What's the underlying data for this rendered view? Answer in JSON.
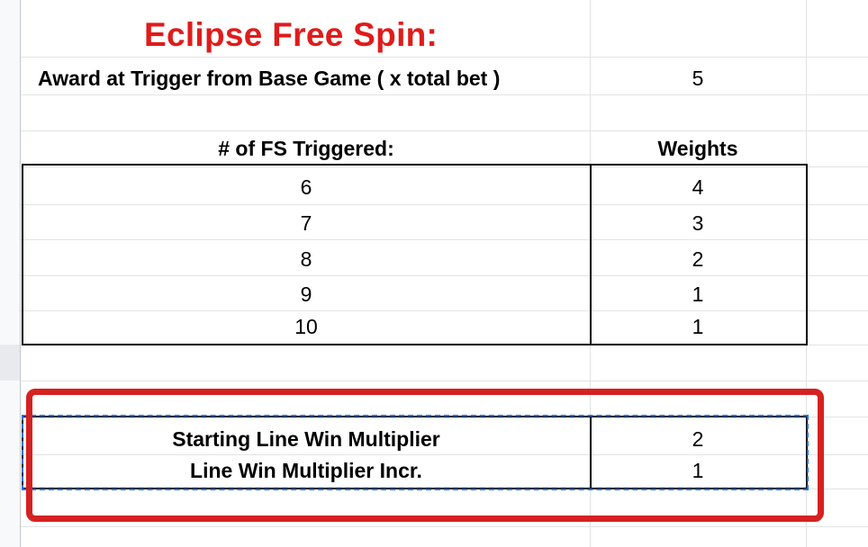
{
  "title": "Eclipse Free Spin:",
  "award": {
    "label": "Award at Trigger from Base Game ( x total bet )",
    "value": "5"
  },
  "fs_table": {
    "header_left": "# of FS Triggered:",
    "header_right": "Weights",
    "rows": [
      {
        "fs": "6",
        "weight": "4"
      },
      {
        "fs": "7",
        "weight": "3"
      },
      {
        "fs": "8",
        "weight": "2"
      },
      {
        "fs": "9",
        "weight": "1"
      },
      {
        "fs": "10",
        "weight": "1"
      }
    ]
  },
  "multiplier": {
    "start_label": "Starting Line Win Multiplier",
    "start_value": "2",
    "incr_label": "Line Win Multiplier Incr.",
    "incr_value": "1"
  },
  "colors": {
    "title": "#e01b1b",
    "highlight_box": "#d62121",
    "selection": "#1a73e8"
  }
}
